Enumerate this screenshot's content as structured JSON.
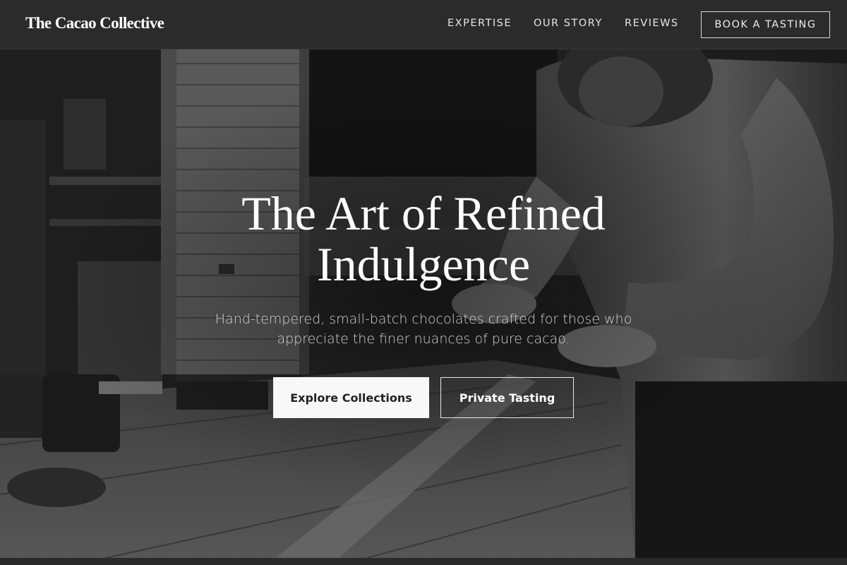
{
  "header": {
    "brand": "The Cacao Collective",
    "nav": {
      "expertise": "EXPERTISE",
      "our_story": "OUR STORY",
      "reviews": "REVIEWS",
      "cta": "BOOK A TASTING"
    }
  },
  "hero": {
    "title_line1": "The Art of Refined",
    "title_line2": "Indulgence",
    "subtitle_line1": "Hand-tempered, small-batch chocolates crafted for those who",
    "subtitle_line2": "appreciate the finer nuances of pure cacao.",
    "primary_button": "Explore Collections",
    "secondary_button": "Private Tasting",
    "background_image": "craftsman-at-workbench-photo"
  },
  "colors": {
    "header_bg": "#2b2b2b",
    "hero_text": "#ffffff",
    "primary_button_bg": "#f8f8f8",
    "page_bg": "#1c1c1c"
  }
}
